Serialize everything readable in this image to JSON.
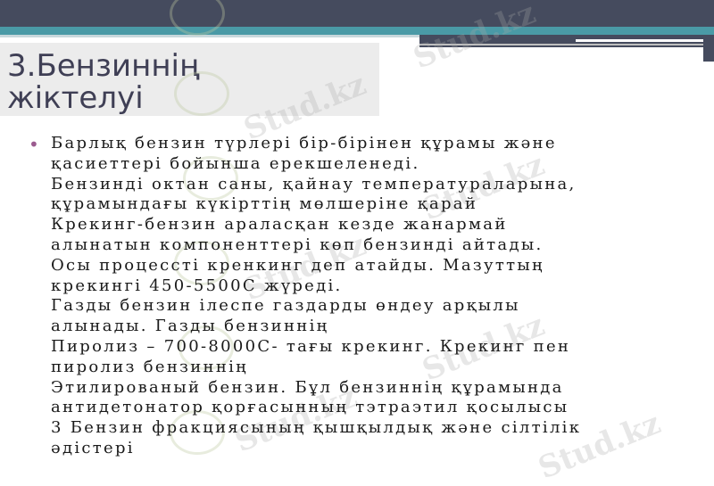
{
  "slide": {
    "title_line1": "3.Бензиннің",
    "title_line2": "жіктелуі",
    "bullet_symbol": "•",
    "lines": [
      "Барлық бензин түрлері бір-бірінен құрамы және",
      "қасиеттері бойынша ерекшеленеді.",
      "Бензинді октан саны, қайнау температураларына,",
      "құрамындағы күкірттің мөлшеріне қарай",
      "Крекинг-бензин араласқан кезде жанармай",
      "алынатын компоненттері көп бензинді айтады.",
      "Осы процессті кренкинг деп атайды. Мазуттың",
      "крекингі 450-5500С жүреді.",
      "Газды бензин ілеспе газдарды өндеу арқылы",
      "алынады. Газды бензиннің",
      "Пиролиз – 700-8000С- тағы крекинг. Крекинг пен",
      "пиролиз бензиннің",
      "Этилированый бензин. Бұл бензиннің құрамында",
      "антидетонатор қорғасынның тэтраэтил қосылысы",
      "3 Бензин фракциясының қышқылдық және сілтілік",
      "әдістері"
    ]
  },
  "watermark": {
    "text": "Stud.kz"
  },
  "colors": {
    "header_dark": "#454b5e",
    "header_teal": "#4a9aa6",
    "title_text": "#3f3f55",
    "bullet": "#9b5b8f"
  }
}
